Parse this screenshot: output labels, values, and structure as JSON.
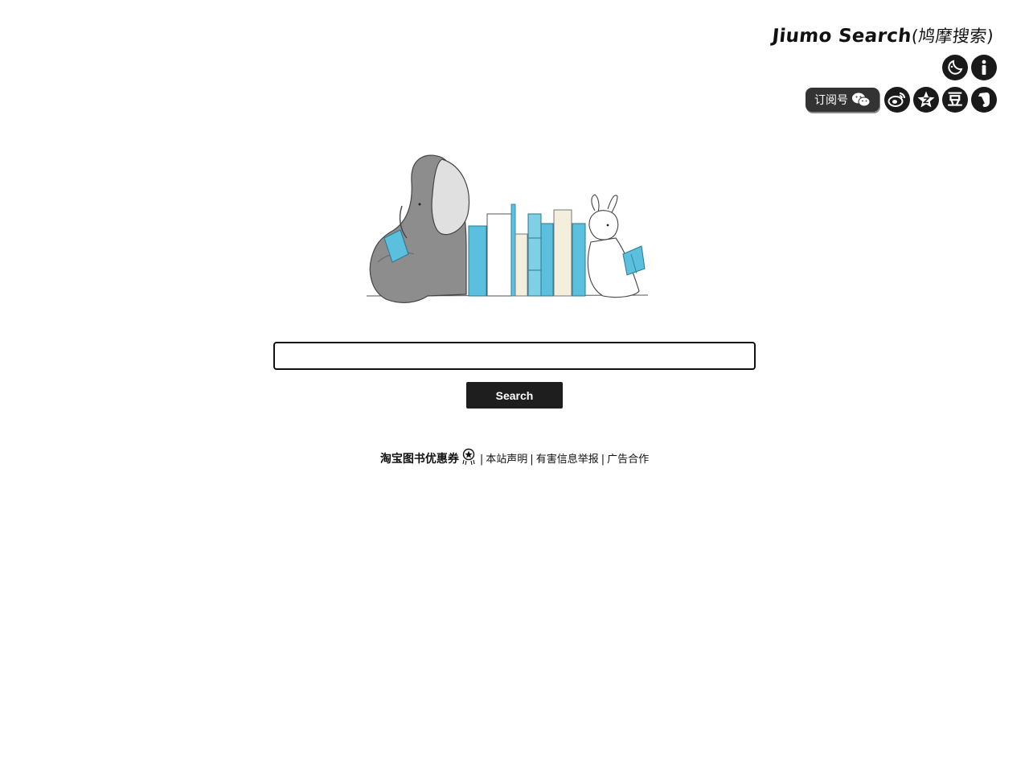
{
  "header": {
    "brand_latin": "Jiumo Search",
    "brand_cn": "(鸠摩搜索)",
    "icons": {
      "theme": "moon-icon",
      "info": "info-icon",
      "wechat_label": "订阅号",
      "wechat": "wechat-icon",
      "weibo": "weibo-icon",
      "favorite": "star-icon",
      "douban": "豆",
      "evernote": "evernote-icon"
    }
  },
  "search": {
    "value": "",
    "button_label": "Search"
  },
  "footer": {
    "promo": "淘宝图书优惠券",
    "separator": "|",
    "statement": "本站声明",
    "report": "有害信息举报",
    "ads": "广告合作"
  }
}
